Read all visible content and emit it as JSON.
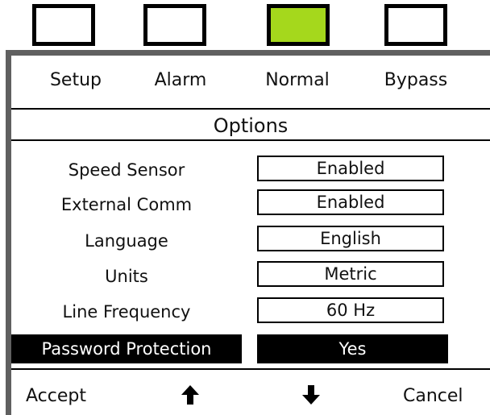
{
  "indicators": [
    {
      "name": "setup",
      "active": false
    },
    {
      "name": "alarm",
      "active": false
    },
    {
      "name": "normal",
      "active": true,
      "color": "#a5d81c"
    },
    {
      "name": "bypass",
      "active": false
    }
  ],
  "tabs": [
    "Setup",
    "Alarm",
    "Normal",
    "Bypass"
  ],
  "title": "Options",
  "options": [
    {
      "label": "Speed Sensor",
      "value": "Enabled"
    },
    {
      "label": "External Comm",
      "value": "Enabled"
    },
    {
      "label": "Language",
      "value": "English"
    },
    {
      "label": "Units",
      "value": "Metric"
    },
    {
      "label": "Line Frequency",
      "value": "60 Hz"
    },
    {
      "label": "Password Protection",
      "value": "Yes",
      "selected": true
    }
  ],
  "footer": {
    "accept": "Accept",
    "up_icon": "up-arrow-icon",
    "down_icon": "down-arrow-icon",
    "cancel": "Cancel"
  },
  "colors": {
    "active_indicator": "#a5d81c",
    "panel_border": "#606060",
    "selection": "#000000"
  }
}
